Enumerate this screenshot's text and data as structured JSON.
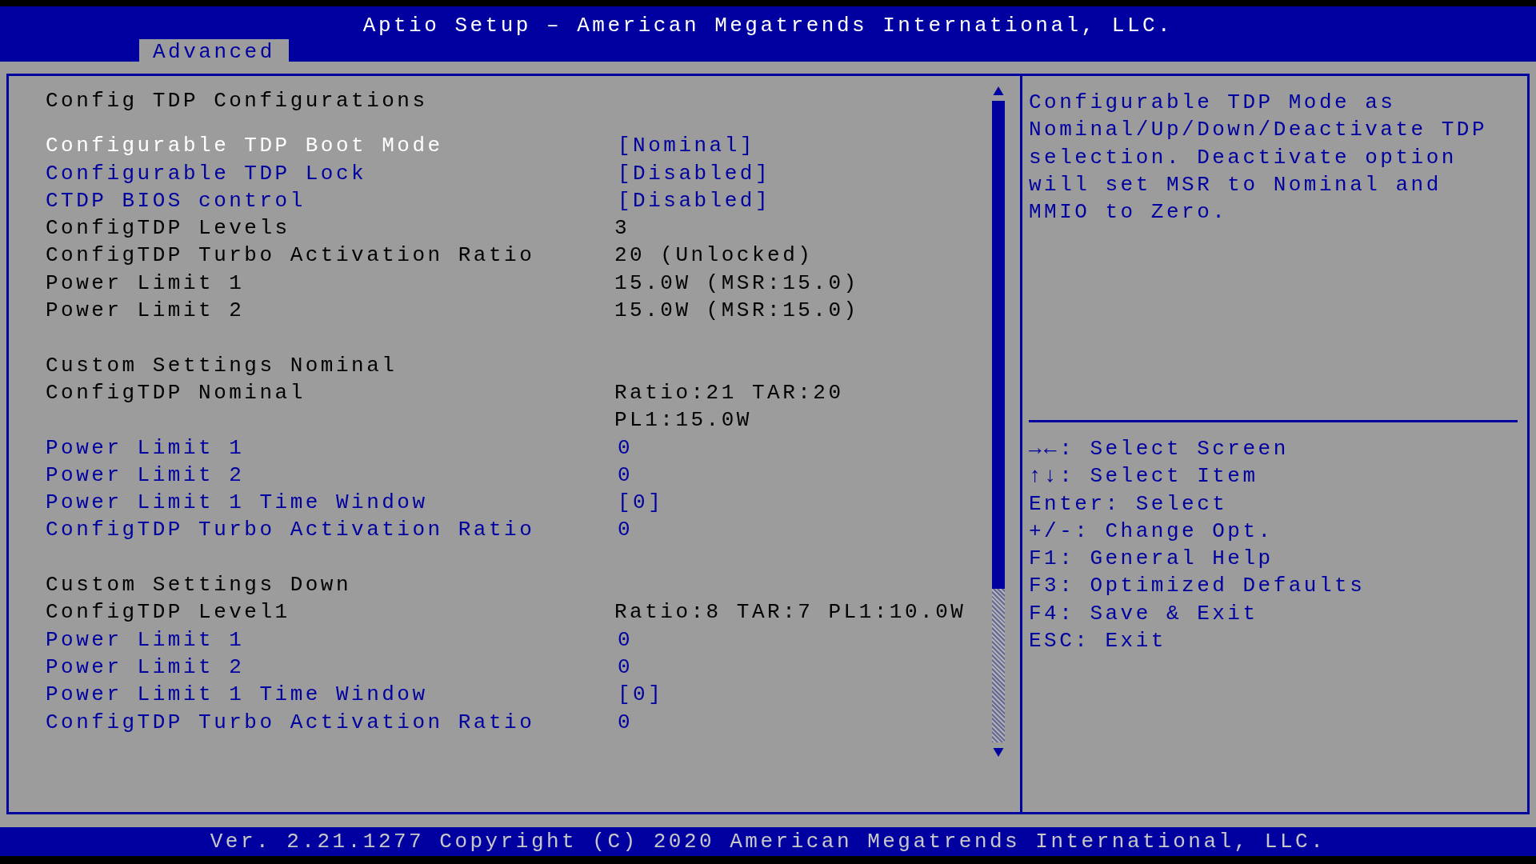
{
  "window": {
    "title": "Aptio Setup – American Megatrends International, LLC."
  },
  "tabs": [
    {
      "label": "Advanced",
      "selected": true
    }
  ],
  "sections": [
    {
      "title": "Config TDP Configurations",
      "items": [
        {
          "label": "Configurable TDP Boot Mode",
          "value": "[Nominal]",
          "kind": "option",
          "selected": true
        },
        {
          "label": "Configurable TDP Lock",
          "value": "[Disabled]",
          "kind": "option",
          "selected": false
        },
        {
          "label": "CTDP BIOS control",
          "value": "[Disabled]",
          "kind": "option",
          "selected": false
        },
        {
          "label": "ConfigTDP Levels",
          "value": "3",
          "kind": "info",
          "selected": false
        },
        {
          "label": "ConfigTDP Turbo Activation Ratio",
          "value": "20 (Unlocked)",
          "kind": "info",
          "selected": false
        },
        {
          "label": "Power Limit 1",
          "value": "15.0W (MSR:15.0)",
          "kind": "info",
          "selected": false
        },
        {
          "label": "Power Limit 2",
          "value": "15.0W (MSR:15.0)",
          "kind": "info",
          "selected": false
        }
      ]
    },
    {
      "title": "Custom Settings Nominal",
      "items": [
        {
          "label": "ConfigTDP Nominal",
          "value": "Ratio:21 TAR:20 PL1:15.0W",
          "kind": "info",
          "selected": false
        },
        {
          "label": "Power Limit 1",
          "value": "0",
          "kind": "option",
          "selected": false
        },
        {
          "label": "Power Limit 2",
          "value": "0",
          "kind": "option",
          "selected": false
        },
        {
          "label": "Power Limit 1 Time Window",
          "value": "[0]",
          "kind": "option",
          "selected": false
        },
        {
          "label": "ConfigTDP Turbo Activation Ratio",
          "value": "0",
          "kind": "option",
          "selected": false
        }
      ]
    },
    {
      "title": "Custom Settings Down",
      "items": [
        {
          "label": "ConfigTDP Level1",
          "value": "Ratio:8 TAR:7 PL1:10.0W",
          "kind": "info",
          "selected": false
        },
        {
          "label": "Power Limit 1",
          "value": "0",
          "kind": "option",
          "selected": false
        },
        {
          "label": "Power Limit 2",
          "value": "0",
          "kind": "option",
          "selected": false
        },
        {
          "label": "Power Limit 1 Time Window",
          "value": "[0]",
          "kind": "option",
          "selected": false
        },
        {
          "label": "ConfigTDP Turbo Activation Ratio",
          "value": "0",
          "kind": "option",
          "selected": false
        }
      ]
    }
  ],
  "help": {
    "text": "Configurable TDP Mode as Nominal/Up/Down/Deactivate TDP selection. Deactivate option will set MSR to Nominal and MMIO to Zero.",
    "keys": [
      "→←: Select Screen",
      "↑↓: Select Item",
      "Enter: Select",
      "+/-: Change Opt.",
      "F1: General Help",
      "F3: Optimized Defaults",
      "F4: Save & Exit",
      "ESC: Exit"
    ]
  },
  "status_bar": "Ver. 2.21.1277 Copyright (C) 2020 American Megatrends International, LLC."
}
